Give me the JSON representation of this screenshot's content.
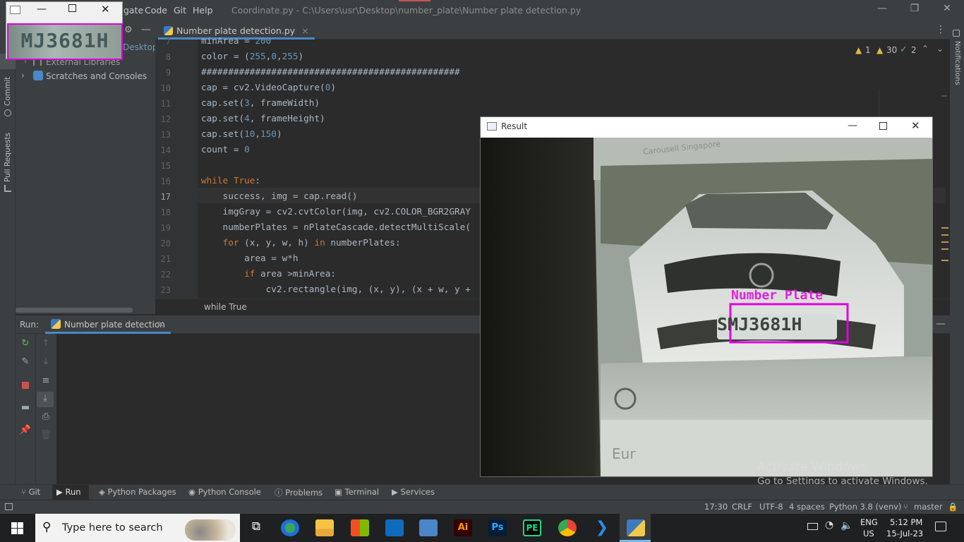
{
  "menu": [
    "gate",
    "Code",
    "Git",
    "Help"
  ],
  "window_title": "Coordinate.py - C:\\Users\\usr\\Desktop\\number_plate\\Number plate detection.py",
  "left_strip": {
    "commit": "Commit",
    "pull_requests": "Pull Requests"
  },
  "project_tree": {
    "path_fragment": "Desktop\\",
    "items": [
      "External Libraries",
      "Scratches and Consoles"
    ]
  },
  "editor": {
    "tab": "Number plate detection.py",
    "inspections": {
      "warnings": "1",
      "weak_warnings": "30",
      "typos": "2"
    },
    "lines": [
      {
        "n": "7",
        "text": "minArea = 200"
      },
      {
        "n": "8",
        "text": "color = (255,0,255)"
      },
      {
        "n": "9",
        "text": "################################################"
      },
      {
        "n": "10",
        "text": "cap = cv2.VideoCapture(0)"
      },
      {
        "n": "11",
        "text": "cap.set(3, frameWidth)"
      },
      {
        "n": "12",
        "text": "cap.set(4, frameHeight)"
      },
      {
        "n": "13",
        "text": "cap.set(10,150)"
      },
      {
        "n": "14",
        "text": "count = 0"
      },
      {
        "n": "15",
        "text": ""
      },
      {
        "n": "16",
        "text": "while True:"
      },
      {
        "n": "17",
        "text": "    success, img = cap.read()"
      },
      {
        "n": "18",
        "text": "    imgGray = cv2.cvtColor(img, cv2.COLOR_BGR2GRAY"
      },
      {
        "n": "19",
        "text": "    numberPlates = nPlateCascade.detectMultiScale("
      },
      {
        "n": "20",
        "text": "    for (x, y, w, h) in numberPlates:"
      },
      {
        "n": "21",
        "text": "        area = w*h"
      },
      {
        "n": "22",
        "text": "        if area >minArea:"
      },
      {
        "n": "23",
        "text": "            cv2.rectangle(img, (x, y), (x + w, y +"
      }
    ],
    "breadcrumb": "while True"
  },
  "run": {
    "label": "Run:",
    "tab": "Number plate detection"
  },
  "right_strip": {
    "notifications": "Notifications"
  },
  "preview_window": {
    "plate_text": "MJ3681H"
  },
  "result_window": {
    "title": "Result",
    "label": "Number Plate",
    "plate_text": "SMJ3681H",
    "sign_text": "Carousell Singapore",
    "bottom_text": "Eur"
  },
  "activate": {
    "line1": "Activate Windows",
    "line2": "Go to Settings to activate Windows."
  },
  "tool_windows": [
    "Git",
    "Run",
    "Python Packages",
    "Python Console",
    "Problems",
    "Terminal",
    "Services"
  ],
  "status_bar": {
    "position": "17:30",
    "line_sep": "CRLF",
    "encoding": "UTF-8",
    "indent": "4 spaces",
    "interpreter": "Python 3.8 (venv)",
    "branch": "master"
  },
  "taskbar": {
    "search_placeholder": "Type here to search",
    "language": "ENG",
    "region": "US",
    "time": "5:12 PM",
    "date": "15-Jul-23",
    "apps": [
      "task-view",
      "edge",
      "file-explorer",
      "store",
      "mail",
      "remote",
      "illustrator",
      "photoshop",
      "pycharm",
      "chrome",
      "vscode",
      "python"
    ]
  },
  "colors": {
    "accent": "#4a88c7",
    "plate_box": "#e000e0",
    "ide_bg": "#2b2b2b"
  }
}
